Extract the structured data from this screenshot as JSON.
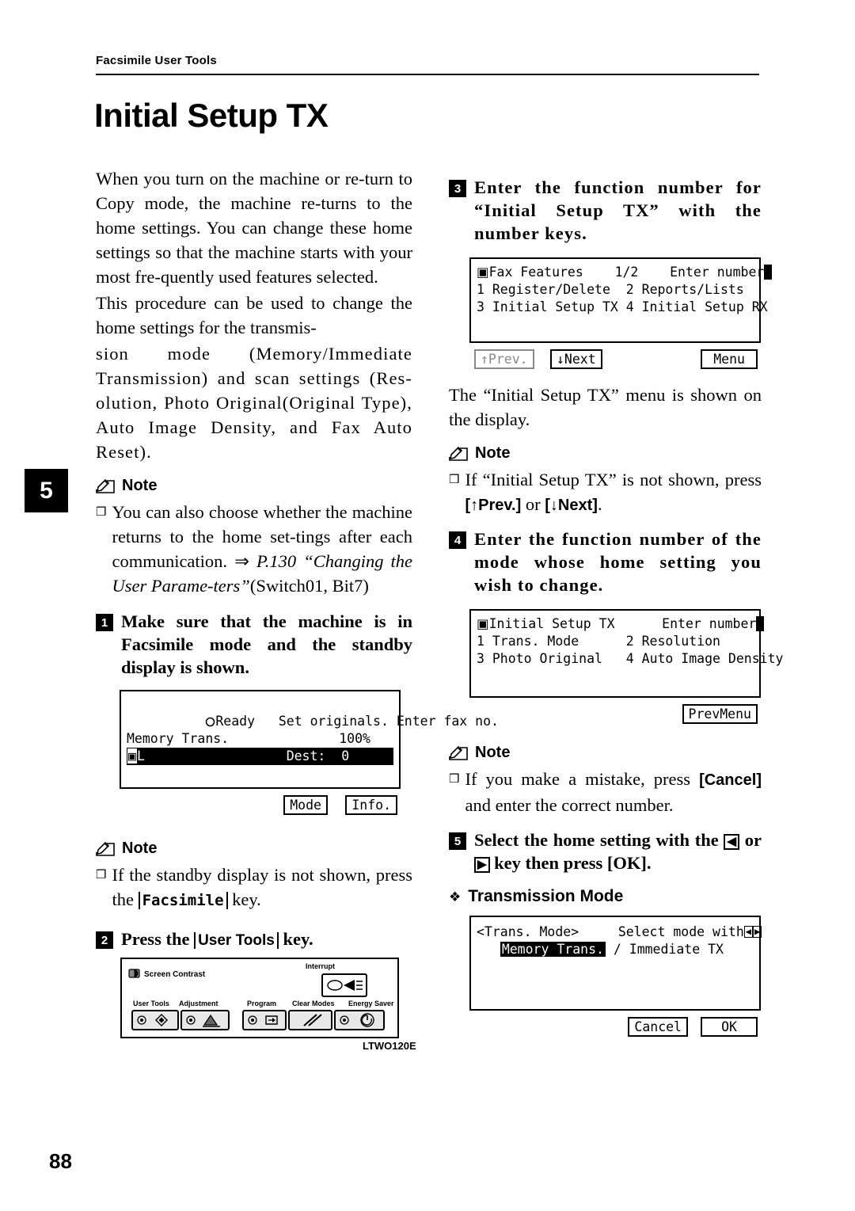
{
  "header": {
    "running_head": "Facsimile User Tools",
    "title": "Initial Setup TX",
    "chapter_tab": "5",
    "page_number": "88",
    "figure_code": "LTWO120E"
  },
  "left_column": {
    "para1": "When you turn on the machine or re-turn to Copy mode, the machine re-turns to the home settings. You can change these home settings so that the machine starts with your most fre-quently used features selected.",
    "para2_a": "This procedure can be used to change the home settings for the transmis-",
    "para2_b": "sion mode (Memory/Immediate Transmission) and scan settings (Res-olution, Photo Original(Original Type), Auto Image Density, and Fax Auto Reset).",
    "note1_label": "Note",
    "note1_bullet": "❒",
    "note1_text": "You can also choose whether the machine returns to the home set-tings after each communication. ⇒ ",
    "note1_ref": "P.130 “Changing the User Parame-ters”",
    "note1_ref_tail": "(Switch01, Bit7)",
    "step1_num": "1",
    "step1_text": "Make sure that the machine is in Facsimile mode and the standby display is shown.",
    "lcd1": {
      "line1_left": "Ready",
      "line1_right": "Set originals. Enter fax no.",
      "line2_left": "Memory Trans.",
      "line2_right": "100%",
      "line3_left": "L",
      "line3_right": "Dest:  0",
      "btn_mode": "Mode",
      "btn_info": "Info."
    },
    "note2_label": "Note",
    "note2_bullet": "❒",
    "note2_text_a": "If the standby display is not shown, press the ",
    "note2_key": "Facsimile",
    "note2_text_b": "key.",
    "step2_num": "2",
    "step2_text_a": "Press the ",
    "step2_key": "User Tools",
    "step2_text_b": " key."
  },
  "control_panel": {
    "screen_contrast": "Screen Contrast",
    "interrupt": "Interrupt",
    "user_tools": "User Tools",
    "adjustment": "Adjustment",
    "program": "Program",
    "clear_modes": "Clear Modes",
    "energy_saver": "Energy Saver"
  },
  "right_column": {
    "step3_num": "3",
    "step3_text": "Enter the function number for “Initial Setup TX” with the number keys.",
    "lcd2": {
      "title_left": "Fax Features",
      "title_mid": "1/2",
      "title_right": "Enter number",
      "row1_left": "1 Register/Delete",
      "row1_right": "2 Reports/Lists",
      "row2_left": "3 Initial Setup TX",
      "row2_right": "4 Initial Setup RX",
      "btn_prev": "↑Prev.",
      "btn_next": "↓Next",
      "btn_menu": "Menu"
    },
    "after_lcd2": "The “Initial Setup TX” menu is shown on the display.",
    "note3_label": "Note",
    "note3_bullet": "❒",
    "note3_text_a": "If “Initial Setup TX” is not shown, press ",
    "note3_key1": "↑Prev.",
    "note3_text_b": " or ",
    "note3_key2": "↓Next",
    "note3_text_c": ".",
    "step4_num": "4",
    "step4_text": "Enter the function number of the mode whose home setting you wish to change.",
    "lcd3": {
      "title_left": "Initial Setup TX",
      "title_right": "Enter number",
      "row1_left": "1 Trans. Mode",
      "row1_right": "2 Resolution",
      "row2_left": "3 Photo Original",
      "row2_right": "4 Auto Image Density",
      "btn_prevmenu": "PrevMenu"
    },
    "note4_label": "Note",
    "note4_bullet": "❒",
    "note4_text_a": "If you make a mistake, press ",
    "note4_key": "Cancel",
    "note4_text_b": " and enter the correct number.",
    "step5_num": "5",
    "step5_text_a": "Select the home setting with the ",
    "step5_key_left": "◀",
    "step5_text_b": " or ",
    "step5_key_right": "▶",
    "step5_text_c": " key then press [OK].",
    "subhead_bullet": "❖",
    "subhead": "Transmission Mode",
    "lcd4": {
      "title_left": "<Trans. Mode>",
      "title_right": "Select mode with",
      "row_selected": "Memory Trans.",
      "row_rest": " / Immediate TX",
      "btn_cancel": "Cancel",
      "btn_ok": "OK"
    }
  }
}
